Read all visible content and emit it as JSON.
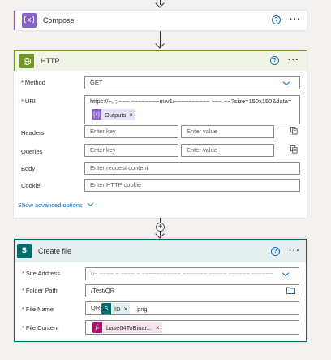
{
  "compose": {
    "title": "Compose",
    "icon": "compose-icon",
    "color": "#8661c5"
  },
  "http": {
    "title": "HTTP",
    "icon": "globe-icon",
    "color": "#709727",
    "method_label": "Method",
    "method_value": "GET",
    "uri_label": "URI",
    "uri_value": "https://~, ; ~~~ ~~~~~~~~m/v1/~~~~~~~~~~ ~~~ ~~?size=150x150&data=",
    "uri_token": "Outputs",
    "headers_label": "Headers",
    "queries_label": "Queries",
    "key_placeholder": "Enter key",
    "value_placeholder": "Enter value",
    "body_label": "Body",
    "body_placeholder": "Enter request content",
    "cookie_label": "Cookie",
    "cookie_placeholder": "Enter HTTP cookie",
    "advanced_link": "Show advanced options"
  },
  "create_file": {
    "title": "Create file",
    "icon": "sharepoint-icon",
    "color": "#036c70",
    "site_label": "Site Address",
    "site_value": "u~ ~~~~ ~ ~~~~ ~ ~~~~~~~~~~~ ~~~~~~~ ~~~~~ ~~~~~~ ~~~~~~",
    "folder_label": "Folder Path",
    "folder_value": "/Test/QR",
    "filename_label": "File Name",
    "filename_prefix": "QR-",
    "filename_token": "ID",
    "filename_suffix": ".png",
    "content_label": "File Content",
    "content_token": "base64ToBinar..."
  }
}
